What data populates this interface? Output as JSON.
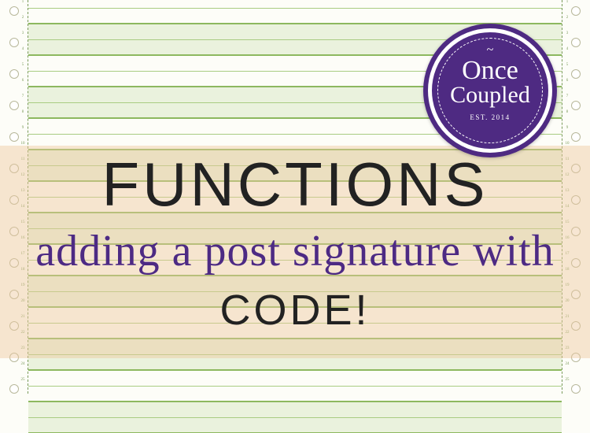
{
  "title": {
    "line1": "FUNCTIONS",
    "line2": "adding a post signature with",
    "line3": "CODE!"
  },
  "badge": {
    "brand_line1": "Once",
    "brand_line2": "Coupled",
    "established": "EST. 2014"
  },
  "colors": {
    "accent_purple": "#4e2a82",
    "paper_green": "#eaf2dd",
    "rule_green": "#8db85f",
    "overlay_peach": "rgba(238,200,158,0.45)"
  }
}
